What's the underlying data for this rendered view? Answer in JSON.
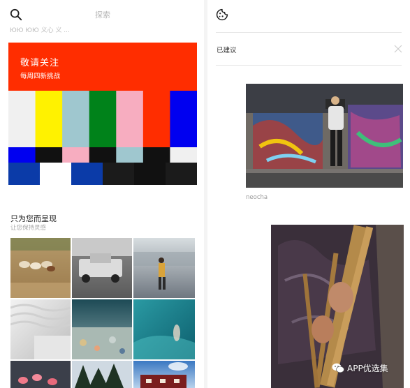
{
  "search": {
    "placeholder": "探索",
    "subtitle": "ЮЮ ЮЮ 义心 义 ..."
  },
  "feature_card": {
    "title": "敬请关注",
    "subtitle": "每周四新挑战",
    "colors": {
      "header": "#ff2d00",
      "row1": [
        "#f0f0f0",
        "#fff200",
        "#9fc7cf",
        "#00821a",
        "#f7adc0",
        "#ff2d00",
        "#0000f0"
      ],
      "row2": [
        "#0000f0",
        "#111111",
        "#f7adc0",
        "#111111",
        "#9fc7cf",
        "#111111",
        "#f0f0f0"
      ],
      "row3": [
        "#0b3ba8",
        "#ffffff",
        "#0b3ba8",
        "#1b1b1b",
        "#111111",
        "#1b1b1b"
      ]
    }
  },
  "for_you": {
    "title": "只为您而呈现",
    "subtitle": "让您保持灵感"
  },
  "suggested": {
    "label": "已建议"
  },
  "photo1": {
    "caption": "neocha"
  },
  "watermark": {
    "text": "APP优选集"
  },
  "icons": {
    "search": "search-icon",
    "cookie": "cookie-icon",
    "close": "close-icon",
    "wechat": "wechat-icon"
  }
}
